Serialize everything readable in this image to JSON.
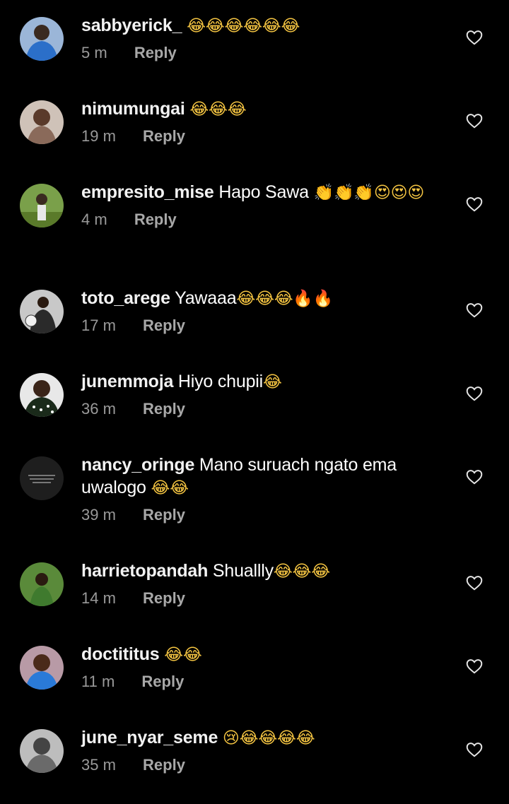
{
  "comments": [
    {
      "username": "sabbyerick_",
      "text": "",
      "emoji": "😂😂😂😂😂😂",
      "time": "5 m",
      "reply": "Reply",
      "avatar": "avatar-woman-blue-dress",
      "avatar_color": "#2b6fc9"
    },
    {
      "username": "nimumungai",
      "text": "",
      "emoji": "😂😂😂",
      "time": "19 m",
      "reply": "Reply",
      "avatar": "avatar-woman-portrait",
      "avatar_color": "#8a6a5a"
    },
    {
      "username": "empresito_mise",
      "text": "Hapo Sawa ",
      "emoji": "👏👏👏😍😍😍",
      "time": "4 m",
      "reply": "Reply",
      "avatar": "avatar-person-outdoors",
      "avatar_color": "#6a8a3a"
    },
    {
      "username": "toto_arege",
      "text": "Yawaaa",
      "emoji": "😂😂😂🔥🔥",
      "time": "17 m",
      "reply": "Reply",
      "avatar": "avatar-man-suit",
      "avatar_color": "#4a4a4a"
    },
    {
      "username": "junemmoja",
      "text": "Hiyo chupii",
      "emoji": "😂",
      "time": "36 m",
      "reply": "Reply",
      "avatar": "avatar-woman-polka-dot",
      "avatar_color": "#2a2a2a"
    },
    {
      "username": "nancy_oringe",
      "text": "Mano suruach ngato ema uwalogo ",
      "emoji": "😂😂",
      "time": "39 m",
      "reply": "Reply",
      "avatar": "avatar-dark-text-graphic",
      "avatar_color": "#1e1e1e"
    },
    {
      "username": "harrietopandah",
      "text": "Shuallly",
      "emoji": "😂😂😂",
      "time": "14 m",
      "reply": "Reply",
      "avatar": "avatar-person-garden",
      "avatar_color": "#3f7a2e"
    },
    {
      "username": "doctititus",
      "text": "",
      "emoji": "😂😂",
      "time": "11 m",
      "reply": "Reply",
      "avatar": "avatar-woman-blue-top",
      "avatar_color": "#a17a86"
    },
    {
      "username": "june_nyar_seme",
      "text": "",
      "emoji": "😢😂😂😂😂",
      "time": "35 m",
      "reply": "Reply",
      "avatar": "avatar-grayscale-portrait",
      "avatar_color": "#9a9a9a"
    }
  ]
}
